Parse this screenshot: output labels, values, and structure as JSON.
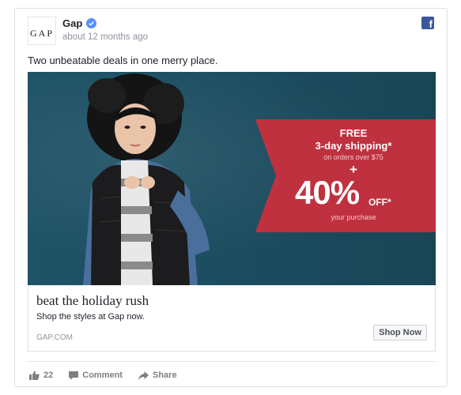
{
  "post": {
    "page_name": "Gap",
    "timestamp": "about 12 months ago",
    "logo_text": "GAP",
    "text": "Two unbeatable deals in one merry place."
  },
  "ad": {
    "free": "FREE",
    "shipping": "3-day shipping*",
    "minimum": "on orders over $75",
    "plus": "+",
    "percent": "40%",
    "off": "OFF*",
    "your_purchase": "your purchase"
  },
  "link": {
    "headline": "beat the holiday rush",
    "description": "Shop the styles at Gap now.",
    "domain": "GAP.COM",
    "cta": "Shop Now"
  },
  "actions": {
    "like_count": "22",
    "comment": "Comment",
    "share": "Share"
  },
  "colors": {
    "facebook_blue": "#3b5998",
    "verified_blue": "#5890ff",
    "banner_red": "#c0313f",
    "background_teal": "#1e5266"
  },
  "icons": [
    "facebook-icon",
    "verified-badge-icon",
    "like-icon",
    "comment-icon",
    "share-icon"
  ]
}
